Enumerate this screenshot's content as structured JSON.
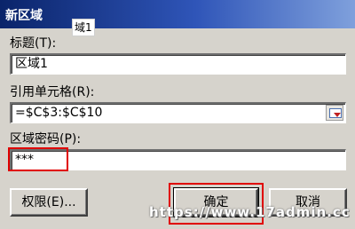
{
  "window": {
    "title": "新区域",
    "overlay_text": "域1"
  },
  "title_field": {
    "label": "标题(T):",
    "value": "区域1"
  },
  "ref_field": {
    "label": "引用单元格(R):",
    "value": "=$C$3:$C$10",
    "collapse_icon": "collapse-range-icon"
  },
  "password_field": {
    "label": "区域密码(P):",
    "value": "***"
  },
  "buttons": {
    "permissions": "权限(E)...",
    "ok": "确定",
    "cancel": "取消"
  },
  "watermark": "https://www.17admin.cc",
  "colors": {
    "highlight": "#e00000",
    "title_gradient_start": "#0a246a"
  }
}
